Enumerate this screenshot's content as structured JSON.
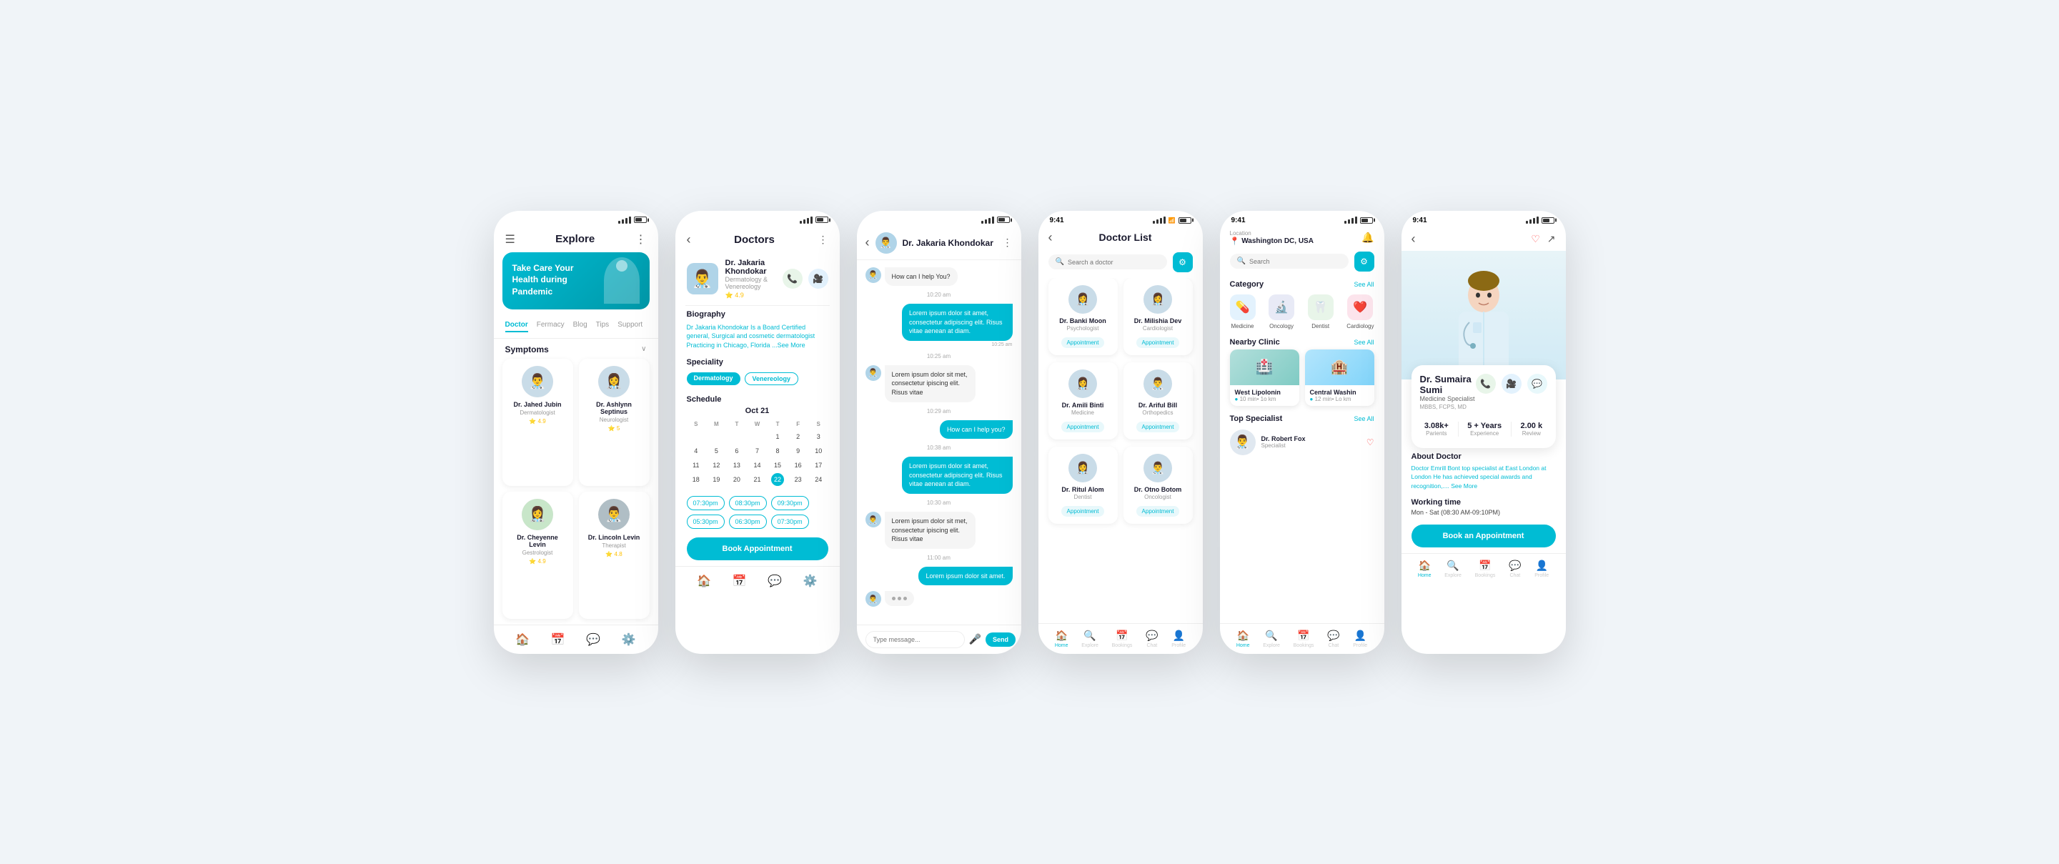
{
  "screen1": {
    "header": {
      "title": "Explore",
      "menu_icon": "☰",
      "more_icon": "⋮"
    },
    "banner": {
      "text": "Take Care Your Health during Pandemic"
    },
    "nav_items": [
      "Doctor",
      "Fermacy",
      "Blog",
      "Tips",
      "Support"
    ],
    "active_nav": 0,
    "symptoms_label": "Symptoms",
    "doctors": [
      {
        "name": "Dr. Jahed Jubin",
        "specialty": "Dermatologist",
        "rating": "4.9"
      },
      {
        "name": "Dr. Ashlynn Septinus",
        "specialty": "Neurologist",
        "rating": "5"
      },
      {
        "name": "Dr. Cheyenne Levin",
        "specialty": "Gestrologist",
        "rating": "4.9"
      },
      {
        "name": "Dr. Lincoln Levin",
        "specialty": "Therapist",
        "rating": "4.8"
      }
    ],
    "bottom_nav": [
      "🏠",
      "📅",
      "💬",
      "⚙️"
    ]
  },
  "screen2": {
    "header": {
      "back": "‹",
      "title": "Doctors",
      "more_icon": "⋮"
    },
    "doctor": {
      "name": "Dr. Jakaria Khondokar",
      "specialty": "Dermatology & Venereology",
      "rating": "4.9"
    },
    "biography_title": "Biography",
    "bio_text": "Dr Jakaria Khondokar Is a Board Certified general, Surgical and cosmetic dermatologist Practicing in Chicago, Florida",
    "see_more": "...See More",
    "speciality_title": "Speciality",
    "tags": [
      "Dermatology",
      "Venereology"
    ],
    "schedule_title": "Schedule",
    "calendar_month": "Oct 21",
    "cal_days_header": [
      "S",
      "M",
      "T",
      "W",
      "T",
      "F",
      "S"
    ],
    "cal_days": [
      "",
      "",
      "",
      "",
      "1",
      "2",
      "3",
      "4",
      "5",
      "6",
      "7",
      "8",
      "9",
      "10",
      "11",
      "12",
      "13",
      "14",
      "15",
      "16",
      "17",
      "18",
      "19",
      "20",
      "21",
      "22",
      "23",
      "24"
    ],
    "active_day": "22",
    "time_slots": [
      "07:30pm",
      "08:30pm",
      "09:30pm",
      "05:30pm",
      "06:30pm",
      "07:30pm"
    ],
    "book_btn": "Book Appointment",
    "bottom_nav": [
      "🏠",
      "📅",
      "💬",
      "⚙️"
    ]
  },
  "screen3": {
    "header": {
      "back": "‹",
      "name": "Dr. Jakaria Khondokar",
      "more_icon": "⋮"
    },
    "messages": [
      {
        "side": "left",
        "text": "How can I help You?",
        "time": ""
      },
      {
        "side": "right",
        "text": "Lorem ipsum dolor sit amet, consectetur adipiscing elit. Risus vitae aenean at diam.",
        "time": "10:25 am"
      },
      {
        "side": "left",
        "text": "Lorem ipsum dolor sit met, consectetur ipiscing elit. Risus vitae",
        "time": "10:28 am"
      },
      {
        "side": "right",
        "text": "How can I help you?",
        "time": "10:29 am"
      },
      {
        "side": "right",
        "text": "Lorem ipsum dolor sit amet, consectetur adipiscing elit. Risus vitae aenean at diam.",
        "time": "10:38 am"
      },
      {
        "side": "left",
        "text": "Lorem ipsum dolor sit met, consectetur ipiscing elit. Risus vitae",
        "time": "10:30 am"
      },
      {
        "side": "right",
        "text": "Lorem ipsum dolor sit amet.",
        "time": "11:00 am"
      }
    ],
    "typing": "...",
    "input_placeholder": "Type message...",
    "send_label": "Send"
  },
  "screen4": {
    "time": "9:41",
    "header": {
      "back": "‹",
      "title": "Doctor List"
    },
    "search_placeholder": "Search a doctor",
    "doctors": [
      {
        "name": "Dr. Banki Moon",
        "specialty": "Psychologist"
      },
      {
        "name": "Dr. Milishia Dev",
        "specialty": "Cardiologist"
      },
      {
        "name": "Dr. Amili Binti",
        "specialty": "Medicine"
      },
      {
        "name": "Dr. Ariful Bill",
        "specialty": "Orthopedics"
      },
      {
        "name": "Dr. Ritul Alom",
        "specialty": "Dentist"
      },
      {
        "name": "Dr. Otno Botom",
        "specialty": "Oncologist"
      }
    ],
    "appointment_label": "Appointment",
    "bottom_nav": [
      {
        "icon": "🏠",
        "label": "Home"
      },
      {
        "icon": "🔍",
        "label": "Explore"
      },
      {
        "icon": "📅",
        "label": "Bookings"
      },
      {
        "icon": "💬",
        "label": "Chat"
      },
      {
        "icon": "👤",
        "label": "Profile"
      }
    ],
    "active_nav": 0
  },
  "screen5": {
    "time": "9:41",
    "location": {
      "label": "Location",
      "name": "Washington DC, USA"
    },
    "search_placeholder": "Search",
    "category_title": "Category",
    "see_all": "See All",
    "categories": [
      {
        "icon": "💊",
        "label": "Medicine",
        "bg": "medicine"
      },
      {
        "icon": "🔬",
        "label": "Oncology",
        "bg": "oncology"
      },
      {
        "icon": "🦷",
        "label": "Dentist",
        "bg": "dentist"
      },
      {
        "icon": "❤️",
        "label": "Cardiology",
        "bg": "cardio"
      }
    ],
    "nearby_title": "Nearby Clinic",
    "clinics": [
      {
        "name": "West Lipolonin",
        "distance": "10 min• 1o km"
      },
      {
        "name": "Central Washin",
        "distance": "12 min• Lo km"
      }
    ],
    "top_specialist_title": "Top Specialist",
    "specialists": [
      {
        "name": "Dr. Robert Fox",
        "title": ""
      }
    ],
    "bottom_nav": [
      {
        "icon": "🏠",
        "label": "Home"
      },
      {
        "icon": "🔍",
        "label": "Explore"
      },
      {
        "icon": "📅",
        "label": "Bookings"
      },
      {
        "icon": "💬",
        "label": "Chat"
      },
      {
        "icon": "👤",
        "label": "Profile"
      }
    ],
    "active_nav": 0
  },
  "screen6": {
    "time": "9:41",
    "doctor": {
      "name": "Dr. Sumaira Sumi",
      "title": "Medicine Specialist",
      "qualifications": "MBBS, FCPS, MD"
    },
    "stats": [
      {
        "value": "3.08k+",
        "label": "Parients"
      },
      {
        "value": "5 + Years",
        "label": "Experience"
      },
      {
        "value": "2.00 k",
        "label": "Review"
      }
    ],
    "about_title": "About Doctor",
    "about_text": "Doctor Emrill Bont top specialist at East London at London He has achieved special awards and recognition,....",
    "see_more": "See More",
    "working_title": "Working time",
    "working_hours": "Mon - Sat (08:30 AM-09:10PM)",
    "book_btn": "Book an Appointment",
    "bottom_nav": [
      {
        "icon": "🏠",
        "label": "Home"
      },
      {
        "icon": "🔍",
        "label": "Explore"
      },
      {
        "icon": "📅",
        "label": "Bookings"
      },
      {
        "icon": "💬",
        "label": "Chat"
      },
      {
        "icon": "👤",
        "label": "Profile"
      }
    ],
    "active_nav": 0
  }
}
